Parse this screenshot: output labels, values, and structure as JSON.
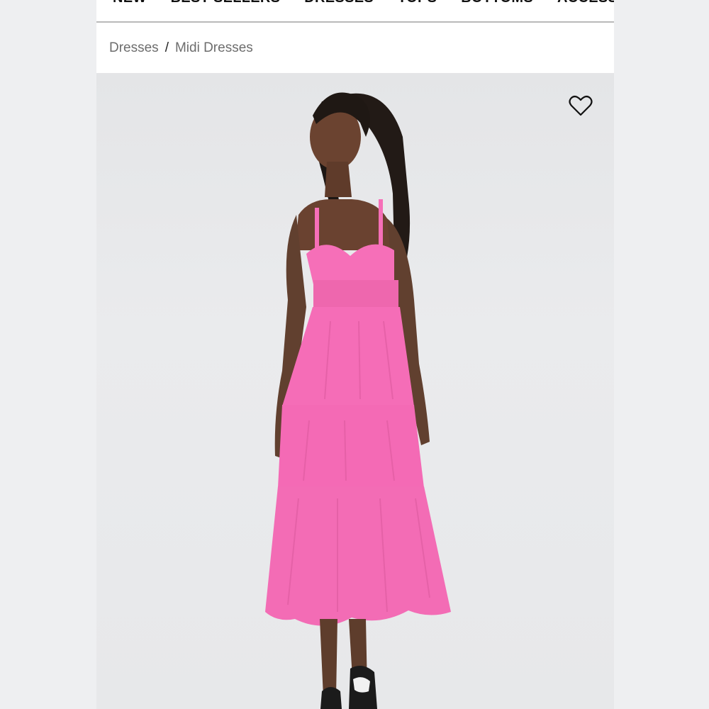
{
  "nav": {
    "items": [
      "NEW",
      "BEST SELLERS",
      "DRESSES",
      "TOPS",
      "BOTTOMS",
      "ACCESSORIES"
    ]
  },
  "breadcrumb": {
    "items": [
      "Dresses",
      "Midi Dresses"
    ],
    "separator": "/"
  },
  "product": {
    "dress_color": "#f66fb8",
    "wishlist_icon": "heart-outline-icon"
  }
}
